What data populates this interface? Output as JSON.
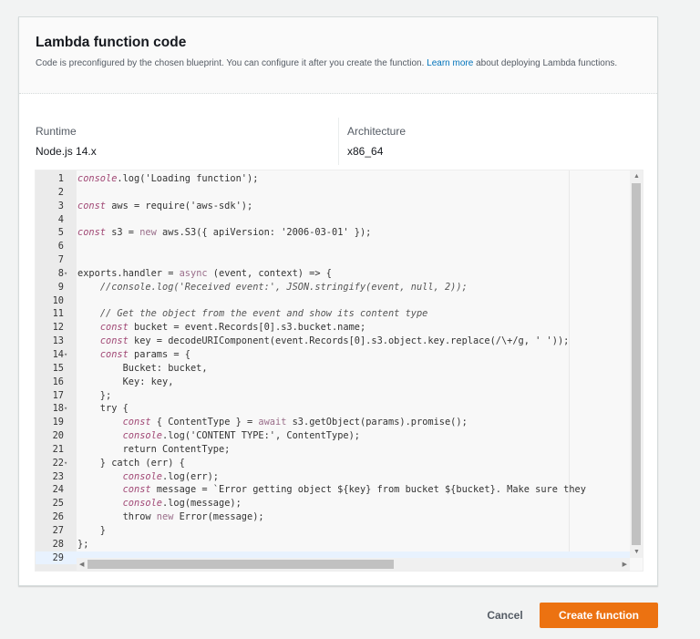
{
  "panel": {
    "title": "Lambda function code",
    "description_before": "Code is preconfigured by the chosen blueprint. You can configure it after you create the function. ",
    "learn_more": "Learn more",
    "description_after": " about deploying Lambda functions."
  },
  "runtime": {
    "label": "Runtime",
    "value": "Node.js 14.x"
  },
  "architecture": {
    "label": "Architecture",
    "value": "x86_64"
  },
  "editor": {
    "lines": [
      {
        "n": "1",
        "t": [
          [
            "kw",
            "console"
          ],
          [
            "",
            ".log('Loading function');"
          ]
        ]
      },
      {
        "n": "2",
        "t": []
      },
      {
        "n": "3",
        "t": [
          [
            "kw",
            "const"
          ],
          [
            "",
            " aws = require('aws-sdk');"
          ]
        ]
      },
      {
        "n": "4",
        "t": []
      },
      {
        "n": "5",
        "t": [
          [
            "kw",
            "const"
          ],
          [
            "",
            " s3 = "
          ],
          [
            "kw2",
            "new"
          ],
          [
            "",
            " aws.S3({ apiVersion: '2006-03-01' });"
          ]
        ]
      },
      {
        "n": "6",
        "t": []
      },
      {
        "n": "7",
        "t": []
      },
      {
        "n": "8",
        "fold": true,
        "t": [
          [
            "",
            "exports.handler = "
          ],
          [
            "kw2",
            "async"
          ],
          [
            "",
            " (event, context) => {"
          ]
        ]
      },
      {
        "n": "9",
        "t": [
          [
            "",
            "    "
          ],
          [
            "cm",
            "//console.log('Received event:', JSON.stringify(event, null, 2));"
          ]
        ]
      },
      {
        "n": "10",
        "t": []
      },
      {
        "n": "11",
        "t": [
          [
            "",
            "    "
          ],
          [
            "cm",
            "// Get the object from the event and show its content type"
          ]
        ]
      },
      {
        "n": "12",
        "t": [
          [
            "",
            "    "
          ],
          [
            "kw",
            "const"
          ],
          [
            "",
            " bucket = event.Records[0].s3.bucket.name;"
          ]
        ]
      },
      {
        "n": "13",
        "t": [
          [
            "",
            "    "
          ],
          [
            "kw",
            "const"
          ],
          [
            "",
            " key = decodeURIComponent(event.Records[0].s3.object.key.replace(/\\+/g, ' '));"
          ]
        ]
      },
      {
        "n": "14",
        "fold": true,
        "t": [
          [
            "",
            "    "
          ],
          [
            "kw",
            "const"
          ],
          [
            "",
            " params = {"
          ]
        ]
      },
      {
        "n": "15",
        "t": [
          [
            "",
            "        Bucket: bucket,"
          ]
        ]
      },
      {
        "n": "16",
        "t": [
          [
            "",
            "        Key: key,"
          ]
        ]
      },
      {
        "n": "17",
        "t": [
          [
            "",
            "    };"
          ]
        ]
      },
      {
        "n": "18",
        "fold": true,
        "t": [
          [
            "",
            "    try {"
          ]
        ]
      },
      {
        "n": "19",
        "t": [
          [
            "",
            "        "
          ],
          [
            "kw",
            "const"
          ],
          [
            "",
            " { ContentType } = "
          ],
          [
            "kw2",
            "await"
          ],
          [
            "",
            " s3.getObject(params).promise();"
          ]
        ]
      },
      {
        "n": "20",
        "t": [
          [
            "",
            "        "
          ],
          [
            "kw",
            "console"
          ],
          [
            "",
            ".log('CONTENT TYPE:', ContentType);"
          ]
        ]
      },
      {
        "n": "21",
        "t": [
          [
            "",
            "        return ContentType;"
          ]
        ]
      },
      {
        "n": "22",
        "fold": true,
        "t": [
          [
            "",
            "    } catch (err) {"
          ]
        ]
      },
      {
        "n": "23",
        "t": [
          [
            "",
            "        "
          ],
          [
            "kw",
            "console"
          ],
          [
            "",
            ".log(err);"
          ]
        ]
      },
      {
        "n": "24",
        "t": [
          [
            "",
            "        "
          ],
          [
            "kw",
            "const"
          ],
          [
            "",
            " message = `Error getting object ${key} from bucket ${bucket}. Make sure they"
          ]
        ]
      },
      {
        "n": "25",
        "t": [
          [
            "",
            "        "
          ],
          [
            "kw",
            "console"
          ],
          [
            "",
            ".log(message);"
          ]
        ]
      },
      {
        "n": "26",
        "t": [
          [
            "",
            "        throw "
          ],
          [
            "kw2",
            "new"
          ],
          [
            "",
            " Error(message);"
          ]
        ]
      },
      {
        "n": "27",
        "t": [
          [
            "",
            "    }"
          ]
        ]
      },
      {
        "n": "28",
        "t": [
          [
            "",
            "};"
          ]
        ]
      },
      {
        "n": "29",
        "active": true,
        "t": []
      }
    ]
  },
  "actions": {
    "cancel": "Cancel",
    "create": "Create function"
  }
}
